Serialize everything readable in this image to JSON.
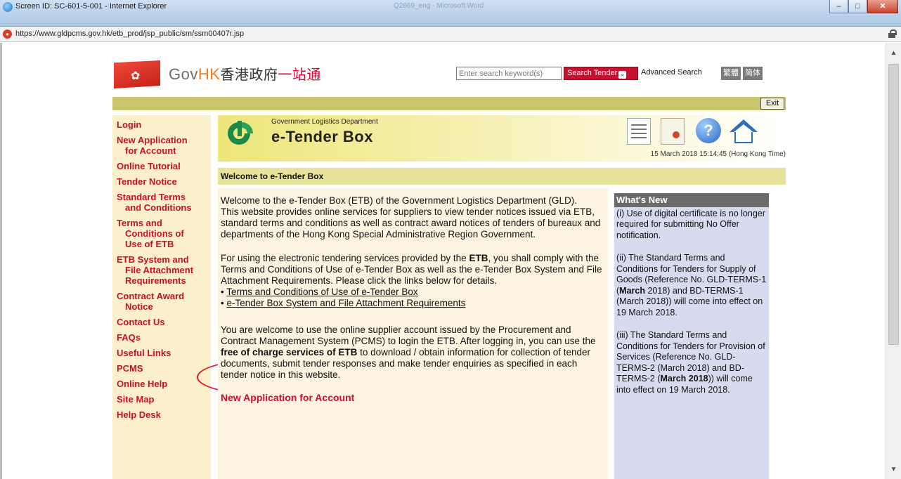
{
  "browser": {
    "title": "Screen ID: SC-601-5-001 - Internet Explorer",
    "background_window": "Q2669_eng - Microsoft Word",
    "url": "https://www.gldpcms.gov.hk/etb_prod/jsp_public/sm/ssm00407r.jsp"
  },
  "header": {
    "brand_gov": "Gov",
    "brand_hk": "HK",
    "brand_zh": "香港政府",
    "brand_zh2": "一站通",
    "search_placeholder": "Enter search keyword(s)",
    "search_button": "Search Tender",
    "advanced_search": "Advanced Search",
    "lang_tc": "繁體",
    "lang_sc": "简体",
    "exit": "Exit"
  },
  "sidebar": {
    "items": [
      {
        "label": "Login"
      },
      {
        "label": "New Application",
        "cont": "for Account"
      },
      {
        "label": "Online Tutorial"
      },
      {
        "label": "Tender Notice"
      },
      {
        "label": "Standard Terms",
        "cont": "and Conditions"
      },
      {
        "label": "Terms and",
        "cont": "Conditions of",
        "cont2": "Use of ETB"
      },
      {
        "label": "ETB System and",
        "cont": "File Attachment",
        "cont2": "Requirements"
      },
      {
        "label": "Contract Award",
        "cont": "Notice"
      },
      {
        "label": "Contact Us"
      },
      {
        "label": "FAQs"
      },
      {
        "label": "Useful Links"
      },
      {
        "label": "PCMS"
      },
      {
        "label": "Online Help"
      },
      {
        "label": "Site Map"
      },
      {
        "label": "Help Desk"
      }
    ]
  },
  "banner": {
    "department": "Government Logistics Department",
    "title": "e-Tender Box",
    "timestamp": "15 March 2018 15:14:45 (Hong Kong Time)"
  },
  "main": {
    "welcome_title": "Welcome to e-Tender Box",
    "p1": "Welcome to the e-Tender Box (ETB) of the Government Logistics Department (GLD).",
    "p1b": "This website provides online services for suppliers to view tender notices issued via ETB, standard terms and conditions as well as contract award notices of tenders of bureaux and departments of the Hong Kong Special Administrative Region Government.",
    "p2_a": "For using the electronic tendering services provided by the ",
    "p2_etb": "ETB",
    "p2_b": ", you shall comply with the Terms and Conditions of Use of e-Tender Box as well as the e-Tender Box System and File Attachment Requirements. Please click the links below for details.",
    "link1": "Terms and Conditions of Use of e-Tender Box",
    "link2": "e-Tender Box System and File Attachment Requirements",
    "p3_a": "You are welcome to use the online supplier account issued by the Procurement and Contract Management System (PCMS) to login the ETB. After logging in, you can use the ",
    "p3_bold": "free of charge services of ETB",
    "p3_b": " to download / obtain information for collection of tender documents, submit tender responses and make tender enquiries as specified in each tender notice in this website.",
    "section_title": "New Application for Account"
  },
  "whats_new": {
    "heading": "What's New",
    "item1": "(i) Use of digital certificate is no longer required for submitting No Offer notification.",
    "item2_a": "(ii) The Standard Terms and Conditions for Tenders for Supply of Goods (Reference No. GLD-TERMS-1 (",
    "item2_bold1": "March",
    "item2_b": " 2018) and BD-TERMS-1 (March 2018)) will come into effect on 19 March 2018.",
    "item3_a": "(iii) The Standard Terms and Conditions for Tenders for Provision of Services (Reference No. GLD-TERMS-2 (March 2018) and BD-TERMS-2 (",
    "item3_bold": "March 2018",
    "item3_b": ")) will come into effect on 19 March 2018."
  },
  "colors": {
    "nav_red": "#c8102e",
    "sidebar_bg": "#fbf0c9",
    "banner_khaki": "#c9c66d",
    "whatsnew_bg": "#d6dbef",
    "highlight_ring": "#e0172f"
  }
}
